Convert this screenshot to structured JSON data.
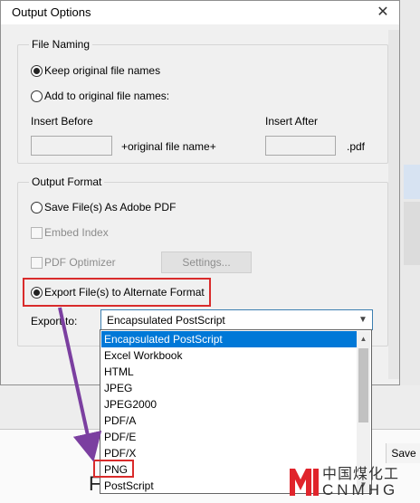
{
  "dialog": {
    "title": "Output Options",
    "close_glyph": "✕"
  },
  "file_naming": {
    "legend": "File Naming",
    "keep_label": "Keep original file names",
    "keep_selected": true,
    "add_label": "Add to original file names:",
    "insert_before_label": "Insert Before",
    "insert_before_value": "",
    "original_name_text": "+original file name+",
    "insert_after_label": "Insert After",
    "insert_after_value": "",
    "ext_text": ".pdf"
  },
  "output_format": {
    "legend": "Output Format",
    "save_pdf_label": "Save File(s) As Adobe PDF",
    "embed_index_label": "Embed Index",
    "pdf_optimizer_label": "PDF Optimizer",
    "settings_button": "Settings...",
    "export_alt_label": "Export File(s) to Alternate Format",
    "export_selected": true,
    "export_to_label": "Export to:",
    "export_to_value": "Encapsulated PostScript"
  },
  "dropdown": {
    "options": [
      "Encapsulated PostScript",
      "Excel Workbook",
      "HTML",
      "JPEG",
      "JPEG2000",
      "PDF/A",
      "PDF/E",
      "PDF/X",
      "PNG",
      "PostScript"
    ],
    "selected_index": 0
  },
  "background": {
    "save_label": "Save",
    "partial_text": "F"
  },
  "watermark": {
    "cn_text": "中国煤化工",
    "en_text": "CNMHG"
  },
  "colors": {
    "highlight": "#d92b2b",
    "arrow": "#7b3fa0",
    "selection": "#0078d7"
  }
}
